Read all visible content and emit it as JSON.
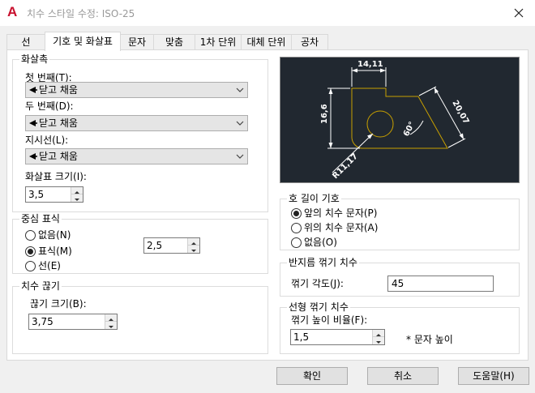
{
  "window": {
    "title": "치수 스타일 수정: ISO-25",
    "close_glyph": "✕"
  },
  "tabs": [
    {
      "label": "선"
    },
    {
      "label": "기호 및 화살표"
    },
    {
      "label": "문자"
    },
    {
      "label": "맞춤"
    },
    {
      "label": "1차 단위"
    },
    {
      "label": "대체 단위"
    },
    {
      "label": "공차"
    }
  ],
  "arrowheads": {
    "title": "화살촉",
    "first_label": "첫 번째(T):",
    "first_value": "닫고 채움",
    "second_label": "두 번째(D):",
    "second_value": "닫고 채움",
    "leader_label": "지시선(L):",
    "leader_value": "닫고 채움",
    "size_label": "화살표 크기(I):",
    "size_value": "3,5"
  },
  "center_marks": {
    "title": "중심 표식",
    "options": [
      {
        "label": "없음(N)",
        "checked": false
      },
      {
        "label": "표식(M)",
        "checked": true
      },
      {
        "label": "선(E)",
        "checked": false
      }
    ],
    "size_value": "2,5"
  },
  "dim_break": {
    "title": "치수 끊기",
    "size_label": "끊기 크기(B):",
    "size_value": "3,75"
  },
  "preview": {
    "dim_top": "14,11",
    "dim_left": "16,6",
    "dim_right": "20,07",
    "dim_angle": "60°",
    "dim_radius": "R11,17",
    "bg_color": "#212830",
    "outline_color": "#c8a000"
  },
  "arc_length": {
    "title": "호 길이 기호",
    "options": [
      {
        "label": "앞의 치수 문자(P)",
        "checked": true
      },
      {
        "label": "위의 치수 문자(A)",
        "checked": false
      },
      {
        "label": "없음(O)",
        "checked": false
      }
    ]
  },
  "radius_jog": {
    "title": "반지름 꺾기 치수",
    "angle_label": "꺾기 각도(J):",
    "angle_value": "45"
  },
  "linear_jog": {
    "title": "선형 꺾기 치수",
    "height_label": "꺾기 높이 비율(F):",
    "height_value": "1,5",
    "suffix": "* 문자 높이"
  },
  "buttons": {
    "ok": "확인",
    "cancel": "취소",
    "help": "도움말(H)"
  }
}
